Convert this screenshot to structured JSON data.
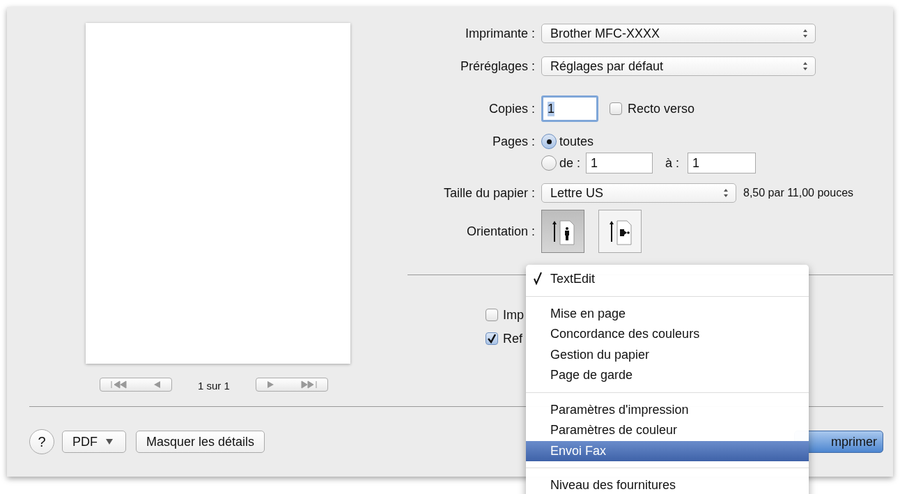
{
  "preview": {
    "page_label": "1 sur 1"
  },
  "form": {
    "printer": {
      "label": "Imprimante :",
      "value": "Brother MFC-XXXX"
    },
    "presets": {
      "label": "Préréglages :",
      "value": "Réglages par défaut"
    },
    "copies": {
      "label": "Copies :",
      "value": "1"
    },
    "duplex": {
      "label": "Recto verso",
      "checked": false
    },
    "pages": {
      "label": "Pages :",
      "options": [
        {
          "label": "toutes",
          "selected": true
        },
        {
          "label": "de :",
          "selected": false
        }
      ],
      "from": "1",
      "to_label": "à :",
      "to": "1"
    },
    "paper_size": {
      "label": "Taille du papier :",
      "value": "Lettre US",
      "dimensions": "8,50 par 11,00 pouces"
    },
    "orientation": {
      "label": "Orientation :",
      "options": [
        {
          "kind": "portrait",
          "selected": true
        },
        {
          "kind": "landscape",
          "selected": false
        }
      ]
    }
  },
  "app_options": [
    {
      "label": "Imp",
      "checked": false
    },
    {
      "label": "Ref",
      "checked": true
    }
  ],
  "menu": {
    "groups": [
      [
        {
          "label": "TextEdit",
          "checked": true,
          "selected": false
        }
      ],
      [
        {
          "label": "Mise en page",
          "checked": false,
          "selected": false
        },
        {
          "label": "Concordance des couleurs",
          "checked": false,
          "selected": false
        },
        {
          "label": "Gestion du papier",
          "checked": false,
          "selected": false
        },
        {
          "label": "Page de garde",
          "checked": false,
          "selected": false
        }
      ],
      [
        {
          "label": "Paramètres d'impression",
          "checked": false,
          "selected": false
        },
        {
          "label": "Paramètres de couleur",
          "checked": false,
          "selected": false
        },
        {
          "label": "Envoi Fax",
          "checked": false,
          "selected": true
        }
      ],
      [
        {
          "label": "Niveau des fournitures",
          "checked": false,
          "selected": false
        }
      ]
    ]
  },
  "buttons": {
    "help": "?",
    "pdf": "PDF",
    "details": "Masquer les détails",
    "print": "mprimer"
  }
}
